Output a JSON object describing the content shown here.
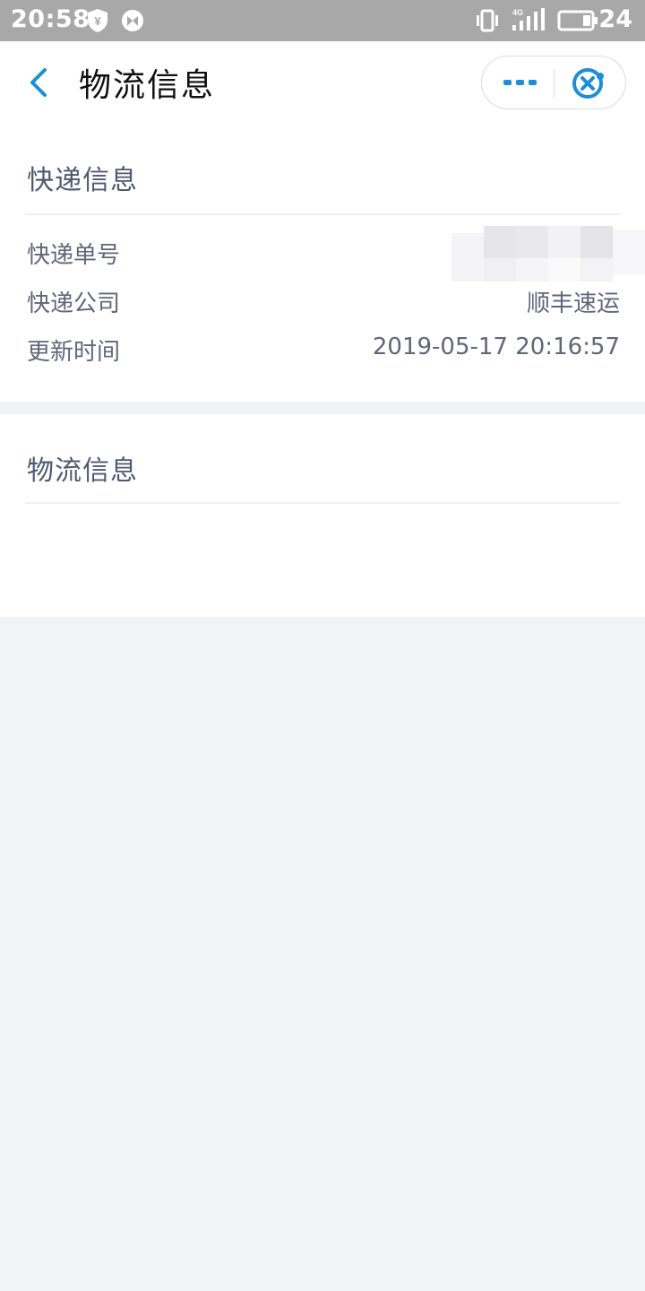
{
  "status_bar": {
    "time": "20:58",
    "battery_level": "24",
    "network": "4G",
    "icons": [
      "shield-yen-icon",
      "browser-icon",
      "vibrate-icon",
      "signal-icon",
      "battery-icon"
    ]
  },
  "nav": {
    "title": "物流信息",
    "back_icon": "chevron-left-icon",
    "more_icon": "more-dots-icon",
    "close_icon": "close-circle-icon",
    "accent": "#1c8ed8"
  },
  "express_section": {
    "title": "快递信息",
    "rows": [
      {
        "label": "快递单号",
        "value": ""
      },
      {
        "label": "快递公司",
        "value": "顺丰速运"
      },
      {
        "label": "更新时间",
        "value": "2019-05-17 20:16:57"
      }
    ]
  },
  "logistics_section": {
    "title": "物流信息"
  }
}
